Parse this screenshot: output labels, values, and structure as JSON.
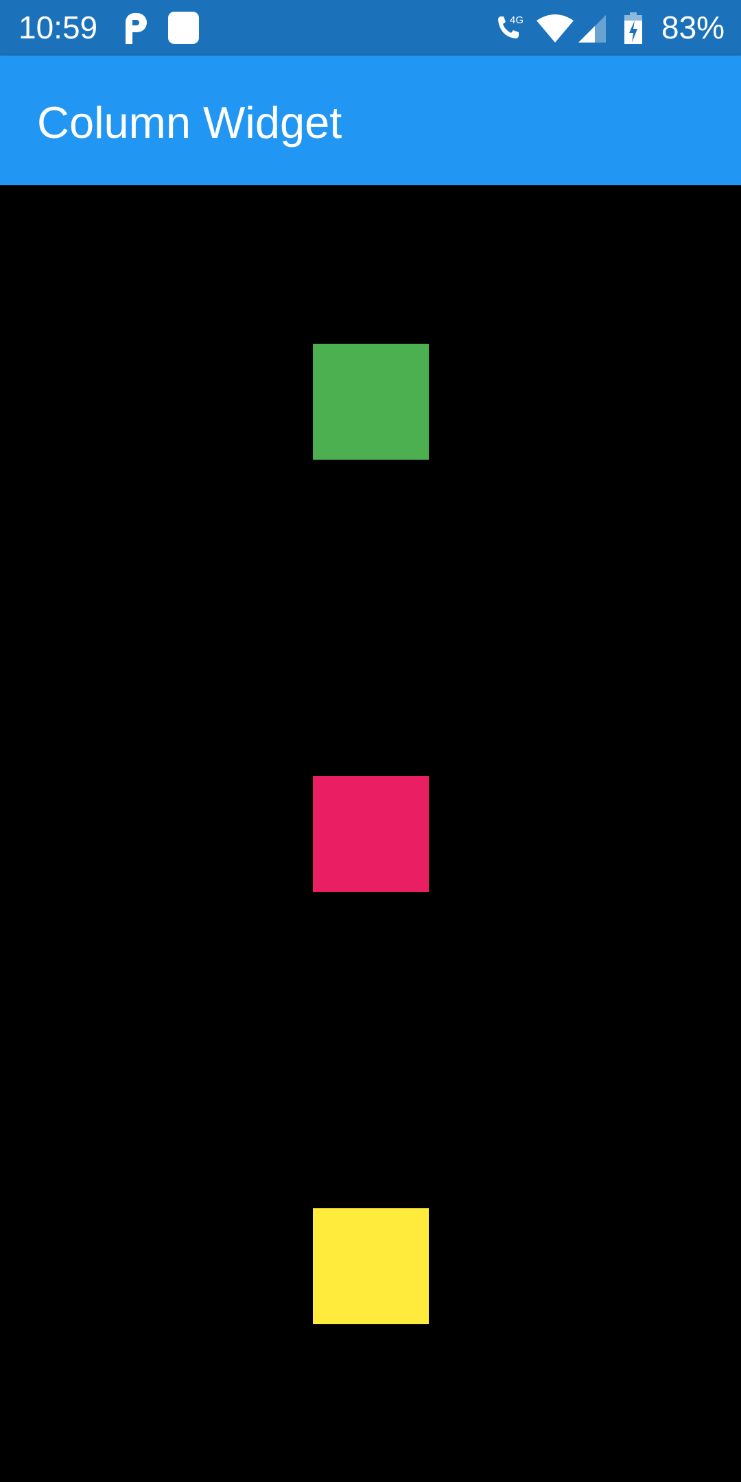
{
  "status_bar": {
    "time": "10:59",
    "network_label": "4G",
    "battery_percent": "83%",
    "icons": [
      "p-icon",
      "square-notification-icon",
      "call-4g-icon",
      "wifi-icon",
      "cell-signal-icon",
      "battery-charging-icon"
    ]
  },
  "app_bar": {
    "title": "Column Widget",
    "color": "#2196f3"
  },
  "column": {
    "boxes": [
      {
        "name": "green-box",
        "color": "#4caf50"
      },
      {
        "name": "pink-box",
        "color": "#e91e63"
      },
      {
        "name": "yellow-box",
        "color": "#ffeb3b"
      }
    ]
  }
}
